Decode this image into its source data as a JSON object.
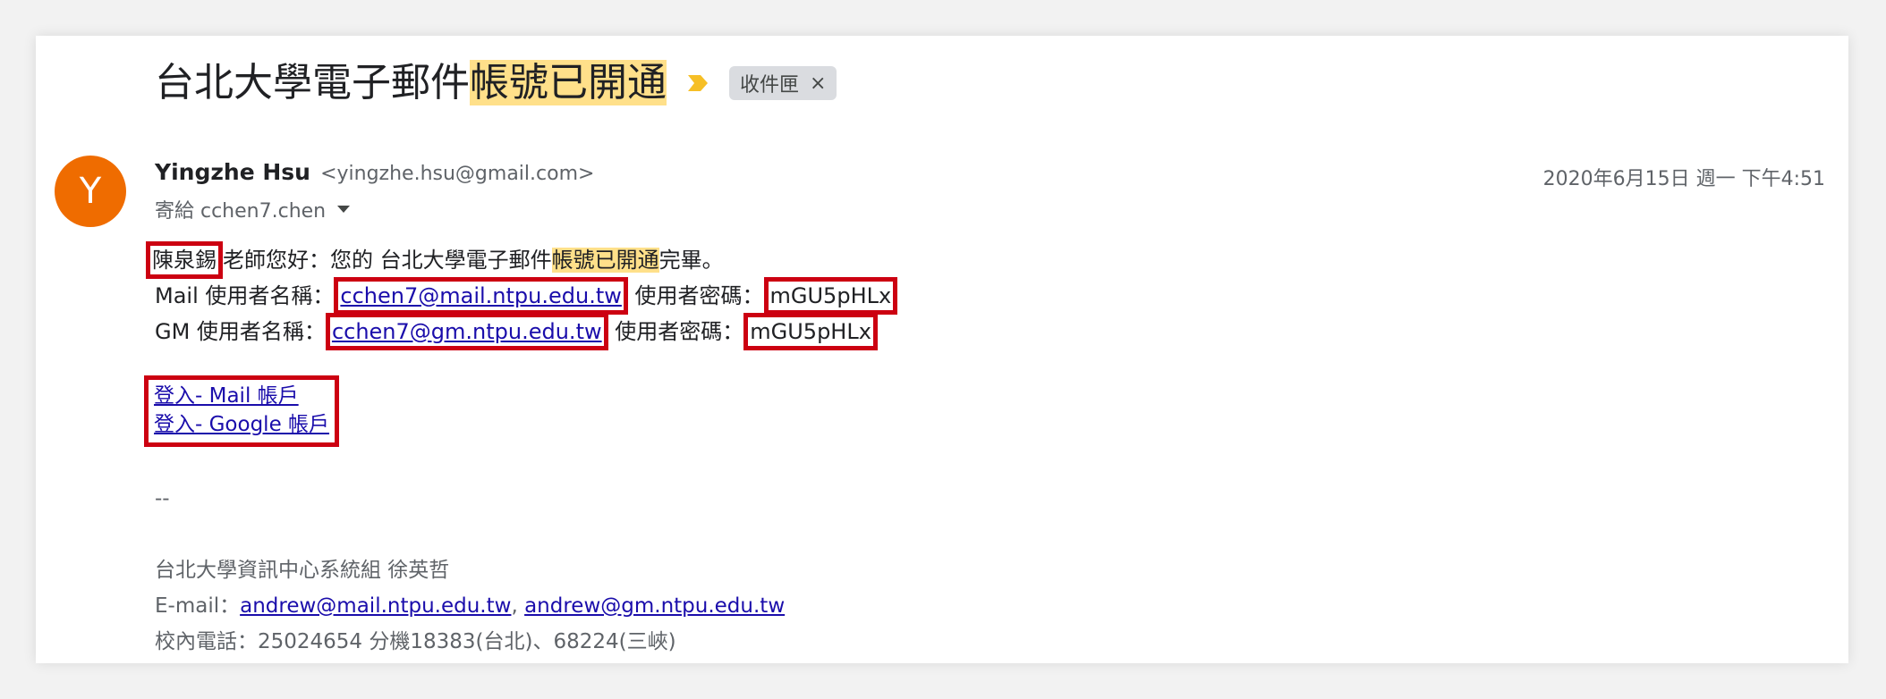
{
  "subject": {
    "prefix": "台北大學電子郵件",
    "highlight": "帳號已開通"
  },
  "label": {
    "name": "收件匣",
    "close": "×"
  },
  "sender": {
    "avatar_letter": "Y",
    "name": "Yingzhe Hsu",
    "email": "<yingzhe.hsu@gmail.com>",
    "date": "2020年6月15日 週一 下午4:51",
    "to": "寄給 cchen7.chen"
  },
  "body": {
    "greeting_name": "陳泉錫",
    "greeting_rest_1": "老師您好：您的 台北大學電子郵件",
    "greeting_highlight": "帳號已開通",
    "greeting_rest_2": "完畢。",
    "mail_user_label": "Mail 使用者名稱：",
    "mail_user": "cchen7@mail.ntpu.edu.tw",
    "mail_pw_label": "使用者密碼：",
    "mail_pw": "mGU5pHLx",
    "gm_user_label": "GM 使用者名稱：",
    "gm_user": "cchen7@gm.ntpu.edu.tw",
    "gm_pw_label": "使用者密碼：",
    "gm_pw": "mGU5pHLx",
    "login_mail": "登入- Mail 帳戶",
    "login_google": "登入- Google 帳戶"
  },
  "signature": {
    "dashes": "--",
    "org": "台北大學資訊中心系統組 徐英哲",
    "email_label": "E-mail：",
    "email1": "andrew@mail.ntpu.edu.tw",
    "sep": ",",
    "email2": "andrew@gm.ntpu.edu.tw",
    "phone": "校內電話：25024654 分機18383(台北)、68224(三峽)"
  },
  "colors": {
    "avatar": "#ef6c00",
    "highlight": "#ffe08a",
    "annotation_box": "#cc0011",
    "link": "#1a0dab",
    "important_marker": "#f6bf26"
  }
}
